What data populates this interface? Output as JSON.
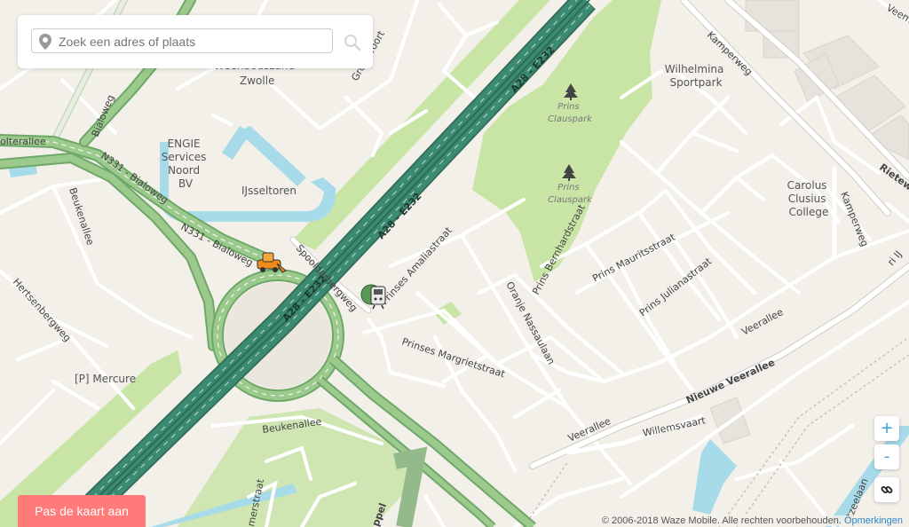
{
  "search": {
    "placeholder": "Zoek een adres of plaats"
  },
  "controls": {
    "zoom_in": "+",
    "zoom_out": "-",
    "link_icon": "link-icon",
    "search_icon": "search-icon"
  },
  "fix_map_button": "Pas de kaart aan",
  "footer": {
    "copyright": "© 2006-2018 Waze Mobile. Alle rechten voorbehouden.",
    "feedback_link": "Opmerkingen"
  },
  "labels": {
    "area_zwolle": "Zwolle",
    "area_partial": "Weenbouszand",
    "engie": [
      "ENGIE",
      "Services",
      "Noord",
      "BV"
    ],
    "ijsseltoren": "IJsseltoren",
    "mercure": "[P] Mercure",
    "wilhelmina": [
      "Wilhelmina",
      "Sportpark"
    ],
    "carolus": [
      "Carolus",
      "Clusius",
      "College"
    ],
    "claus1": [
      "Prins",
      "Clauspark"
    ],
    "claus2": [
      "Prins",
      "Clauspark"
    ]
  },
  "roads": {
    "bialoweg_top": "Bialoweg",
    "holterallee": "olterallee",
    "n331_a": "N331 - Bialoweg",
    "n331_b": "N331 - Bialoweg",
    "beukenallee_w": "Beukenallee",
    "hertsenbergweg": "Hertsenbergweg",
    "a28_top": "A28 - E232",
    "a28_mid": "A28 - E232",
    "a28_low": "A28 - E232",
    "groot_voort": "Groot Voort",
    "spoolderbergweg": "Spoolderbergweg",
    "amalia": "Prinses Amaliastraat",
    "margriet": "Prinses Margrietstraat",
    "oranje": "Oranje Nassaulaan",
    "bernhard": "Prins Bernhardstraat",
    "maurits": "Prins Mauritsstraat",
    "juliana": "Prins Julianastraat",
    "veerallee_e": "Veerallee",
    "veerallee_s": "Veerallee",
    "nieuwe_veerallee": "Nieuwe Veerallee",
    "willemsvaart": "Willemsvaart",
    "beukenallee_s": "Beukenallee",
    "kamperweg_n": "Kamperweg",
    "kamperweg_e": "Kamperweg",
    "rieteweg": "Rietewe",
    "veemarkt": "Veema",
    "ri": "ri IJ",
    "sluis": "stzeelaan",
    "appel": "ppel",
    "merstraat": "merstraat"
  }
}
